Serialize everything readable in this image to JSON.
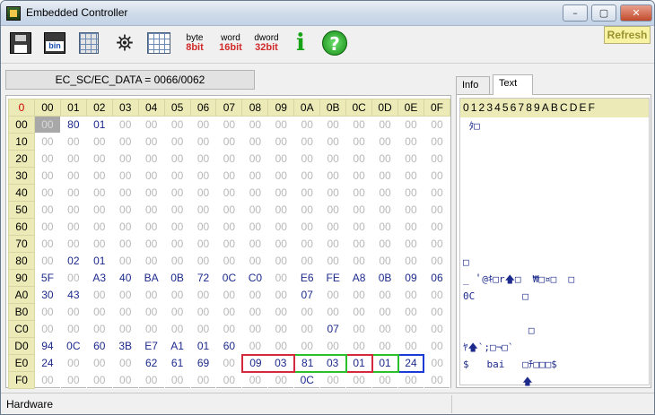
{
  "window": {
    "title": "Embedded Controller",
    "minimize": "–",
    "maximize": "▢",
    "close": "✕"
  },
  "toolbar": {
    "buttons": [
      {
        "icon": "save-disk-icon"
      },
      {
        "icon": "bin-file-icon",
        "label": "bin"
      },
      {
        "icon": "load-icon"
      },
      {
        "icon": "binoculars-icon"
      },
      {
        "icon": "grid-table-icon"
      },
      {
        "icon": "byte-mode-icon",
        "top": "byte",
        "bottom": "8bit",
        "color": "#d02a2a"
      },
      {
        "icon": "word-mode-icon",
        "top": "word",
        "bottom": "16bit",
        "color": "#d02a2a"
      },
      {
        "icon": "dword-mode-icon",
        "top": "dword",
        "bottom": "32bit",
        "color": "#d02a2a"
      },
      {
        "icon": "info-icon",
        "label": "i"
      },
      {
        "icon": "help-icon",
        "label": "?"
      }
    ],
    "refresh": "Refresh"
  },
  "address_bar": "EC_SC/EC_DATA = 0066/0062",
  "hex_table": {
    "corner": "0",
    "columns": [
      "00",
      "01",
      "02",
      "03",
      "04",
      "05",
      "06",
      "07",
      "08",
      "09",
      "0A",
      "0B",
      "0C",
      "0D",
      "0E",
      "0F"
    ],
    "rows": [
      {
        "label": "00",
        "cells": [
          "00",
          "80",
          "01",
          "00",
          "00",
          "00",
          "00",
          "00",
          "00",
          "00",
          "00",
          "00",
          "00",
          "00",
          "00",
          "00"
        ]
      },
      {
        "label": "10",
        "cells": [
          "00",
          "00",
          "00",
          "00",
          "00",
          "00",
          "00",
          "00",
          "00",
          "00",
          "00",
          "00",
          "00",
          "00",
          "00",
          "00"
        ]
      },
      {
        "label": "20",
        "cells": [
          "00",
          "00",
          "00",
          "00",
          "00",
          "00",
          "00",
          "00",
          "00",
          "00",
          "00",
          "00",
          "00",
          "00",
          "00",
          "00"
        ]
      },
      {
        "label": "30",
        "cells": [
          "00",
          "00",
          "00",
          "00",
          "00",
          "00",
          "00",
          "00",
          "00",
          "00",
          "00",
          "00",
          "00",
          "00",
          "00",
          "00"
        ]
      },
      {
        "label": "40",
        "cells": [
          "00",
          "00",
          "00",
          "00",
          "00",
          "00",
          "00",
          "00",
          "00",
          "00",
          "00",
          "00",
          "00",
          "00",
          "00",
          "00"
        ]
      },
      {
        "label": "50",
        "cells": [
          "00",
          "00",
          "00",
          "00",
          "00",
          "00",
          "00",
          "00",
          "00",
          "00",
          "00",
          "00",
          "00",
          "00",
          "00",
          "00"
        ]
      },
      {
        "label": "60",
        "cells": [
          "00",
          "00",
          "00",
          "00",
          "00",
          "00",
          "00",
          "00",
          "00",
          "00",
          "00",
          "00",
          "00",
          "00",
          "00",
          "00"
        ]
      },
      {
        "label": "70",
        "cells": [
          "00",
          "00",
          "00",
          "00",
          "00",
          "00",
          "00",
          "00",
          "00",
          "00",
          "00",
          "00",
          "00",
          "00",
          "00",
          "00"
        ]
      },
      {
        "label": "80",
        "cells": [
          "00",
          "02",
          "01",
          "00",
          "00",
          "00",
          "00",
          "00",
          "00",
          "00",
          "00",
          "00",
          "00",
          "00",
          "00",
          "00"
        ]
      },
      {
        "label": "90",
        "cells": [
          "5F",
          "00",
          "A3",
          "40",
          "BA",
          "0B",
          "72",
          "0C",
          "C0",
          "00",
          "E6",
          "FE",
          "A8",
          "0B",
          "09",
          "06"
        ]
      },
      {
        "label": "A0",
        "cells": [
          "30",
          "43",
          "00",
          "00",
          "00",
          "00",
          "00",
          "00",
          "00",
          "00",
          "07",
          "00",
          "00",
          "00",
          "00",
          "00"
        ]
      },
      {
        "label": "B0",
        "cells": [
          "00",
          "00",
          "00",
          "00",
          "00",
          "00",
          "00",
          "00",
          "00",
          "00",
          "00",
          "00",
          "00",
          "00",
          "00",
          "00"
        ]
      },
      {
        "label": "C0",
        "cells": [
          "00",
          "00",
          "00",
          "00",
          "00",
          "00",
          "00",
          "00",
          "00",
          "00",
          "00",
          "07",
          "00",
          "00",
          "00",
          "00"
        ]
      },
      {
        "label": "D0",
        "cells": [
          "94",
          "0C",
          "60",
          "3B",
          "E7",
          "A1",
          "01",
          "60",
          "00",
          "00",
          "00",
          "00",
          "00",
          "00",
          "00",
          "00"
        ]
      },
      {
        "label": "E0",
        "cells": [
          "24",
          "00",
          "00",
          "00",
          "62",
          "61",
          "69",
          "00",
          "09",
          "03",
          "81",
          "03",
          "01",
          "01",
          "24",
          "00"
        ]
      },
      {
        "label": "F0",
        "cells": [
          "00",
          "00",
          "00",
          "00",
          "00",
          "00",
          "00",
          "00",
          "00",
          "00",
          "0C",
          "00",
          "00",
          "00",
          "00",
          "00"
        ]
      }
    ],
    "selected_cell": {
      "row": 0,
      "col": 0
    },
    "highlights": [
      {
        "row": 14,
        "start": 8,
        "end": 9,
        "color": "#d4283c"
      },
      {
        "row": 14,
        "start": 10,
        "end": 11,
        "color": "#2cbf2c"
      },
      {
        "row": 14,
        "start": 12,
        "end": 12,
        "color": "#d4283c"
      },
      {
        "row": 14,
        "start": 13,
        "end": 13,
        "color": "#2cbf2c"
      },
      {
        "row": 14,
        "start": 14,
        "end": 14,
        "color": "#1c3bd6"
      }
    ]
  },
  "tabs": {
    "info": "Info",
    "text": "Text"
  },
  "text_view": {
    "header": "0123456789ABCDEF",
    "lines": [
      " ﾀ□",
      "",
      "",
      "",
      "",
      "",
      "",
      "",
      "□",
      "_  ﾟ@ｷ□r🡅□  ₩□¤□  □",
      "0C        □",
      "",
      "           □",
      "ﾔ🡅`;□¬□`",
      "$   bai   □ﾁ□□□$",
      "          🡅"
    ]
  },
  "status": {
    "left": "Hardware"
  }
}
